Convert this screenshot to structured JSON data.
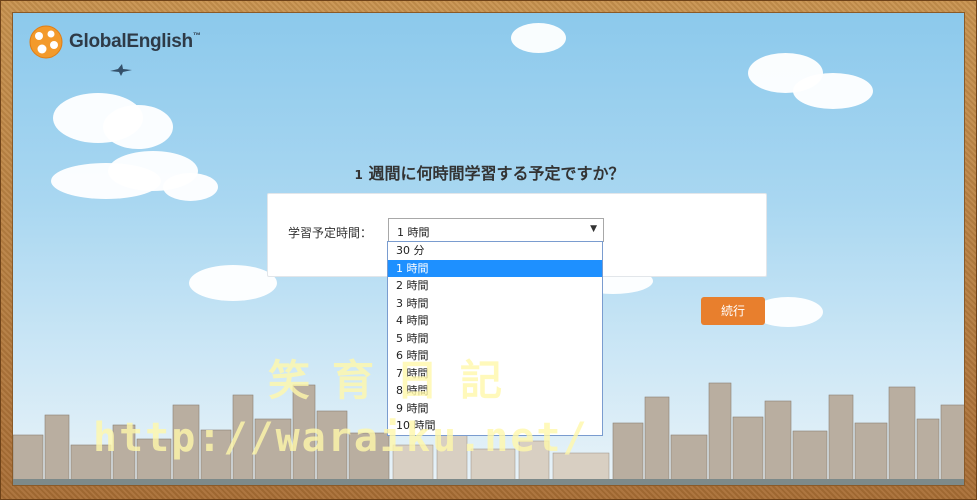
{
  "brand": {
    "name": "GlobalEnglish",
    "tm": "™"
  },
  "question": {
    "number": "1",
    "text": "週間に何時間学習する予定ですか？"
  },
  "form": {
    "label": "学習予定時間：",
    "selected": "1 時間",
    "options": [
      "30 分",
      "1 時間",
      "2 時間",
      "3 時間",
      "4 時間",
      "5 時間",
      "6 時間",
      "7 時間",
      "8 時間",
      "9 時間",
      "10 時間"
    ],
    "selected_index": 1
  },
  "continue_label": "続行",
  "watermark": {
    "line1": "笑育日記",
    "line2": "http://waraiku.net/"
  },
  "colors": {
    "accent": "#e87f2d",
    "highlight": "#1e90ff",
    "sky": "#a9d7f1"
  }
}
